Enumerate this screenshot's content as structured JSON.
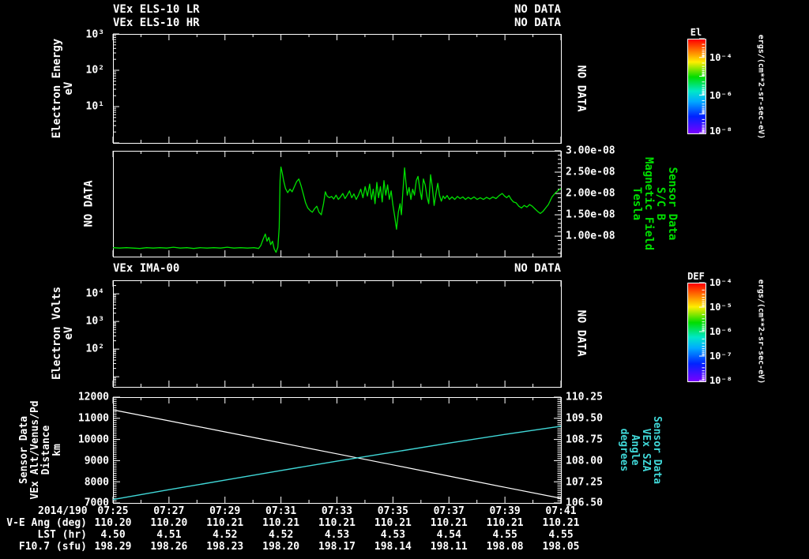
{
  "colors": {
    "white": "#ffffff",
    "green": "#00e000",
    "cyan": "#40d8d8",
    "background": "#000000"
  },
  "header": {
    "title1": "VEx ELS-10 LR",
    "title2": "VEx ELS-10 HR",
    "status1": "NO DATA",
    "status2": "NO DATA"
  },
  "els_panel": {
    "ylabel": "Electron Energy",
    "yunit": "eV",
    "yticks": [
      "10³",
      "10²",
      "10¹"
    ],
    "side_status": "NO DATA",
    "colorbar": {
      "title": "El",
      "tick_labels": [
        "10⁻⁴",
        "10⁻⁶",
        "10⁻⁸"
      ],
      "units": "ergs/(cm**2-sr-sec-eV)"
    }
  },
  "mag_panel": {
    "left_status": "NO DATA",
    "ytick_labels": [
      "3.00e-08",
      "2.50e-08",
      "2.00e-08",
      "1.50e-08",
      "1.00e-08"
    ],
    "side_labels": [
      "Sensor Data",
      "S/C B",
      "Magnetic Field",
      "Tesla"
    ]
  },
  "ima_panel": {
    "title": "VEx IMA-00",
    "status": "NO DATA",
    "ylabel": "Electron Volts",
    "yunit": "eV",
    "yticks": [
      "10⁴",
      "10³",
      "10²"
    ],
    "side_status": "NO DATA",
    "colorbar": {
      "title": "DEF",
      "tick_labels": [
        "10⁻⁴",
        "10⁻⁵",
        "10⁻⁶",
        "10⁻⁷",
        "10⁻⁸"
      ],
      "units": "ergs/(cm**2-sr-sec-eV)"
    }
  },
  "bottom_panel": {
    "left_ticks": [
      "12000",
      "11000",
      "10000",
      "9000",
      "8000",
      "7000"
    ],
    "right_ticks": [
      "110.25",
      "109.50",
      "108.75",
      "108.00",
      "107.25",
      "106.50"
    ],
    "left_labels": [
      "Sensor Data",
      "VEx Alt/Venus/Pd",
      "Distance",
      "km"
    ],
    "right_labels": [
      "Sensor Data",
      "VEx SZA",
      "Angle",
      "degrees"
    ]
  },
  "footer": {
    "date_label": "2014/190",
    "times": [
      "07:25",
      "07:27",
      "07:29",
      "07:31",
      "07:33",
      "07:35",
      "07:37",
      "07:39",
      "07:41"
    ],
    "rows": [
      {
        "label": "V-E Ang (deg)",
        "values": [
          "110.20",
          "110.20",
          "110.21",
          "110.21",
          "110.21",
          "110.21",
          "110.21",
          "110.21",
          "110.21"
        ]
      },
      {
        "label": "LST (hr)",
        "values": [
          "4.50",
          "4.51",
          "4.52",
          "4.52",
          "4.53",
          "4.53",
          "4.54",
          "4.55",
          "4.55"
        ]
      },
      {
        "label": "F10.7 (sfu)",
        "values": [
          "198.29",
          "198.26",
          "198.23",
          "198.20",
          "198.17",
          "198.14",
          "198.11",
          "198.08",
          "198.05"
        ]
      }
    ]
  },
  "chart_data": [
    {
      "type": "heatmap",
      "title": "VEx ELS-10 LR / VEx ELS-10 HR",
      "status": "NO DATA",
      "ylabel": "Electron Energy (eV)",
      "y_scale": "log",
      "ylim": [
        1,
        1000
      ],
      "x_range": [
        "07:25",
        "07:41"
      ],
      "colorbar": {
        "title": "El",
        "units": "ergs/(cm**2-sr-sec-eV)",
        "range": [
          0.001,
          1e-08
        ],
        "tick_labels": [
          "10^-4",
          "10^-6",
          "10^-8"
        ]
      },
      "data": []
    },
    {
      "type": "line",
      "title": "Sensor Data S/C B Magnetic Field (Tesla)",
      "left_status": "NO DATA",
      "x_range": [
        "07:25",
        "07:41"
      ],
      "ylim": [
        5.2e-09,
        3e-08
      ],
      "yticks": [
        3e-08,
        2.5e-08,
        2e-08,
        1.5e-08,
        1e-08
      ],
      "series": [
        {
          "name": "S/C B Magnetic Field (Tesla)",
          "color": "#00e000",
          "units_note": "points are [x_fraction_of_time_axis, B_in_1e-8_Tesla]",
          "points": [
            [
              0.0,
              0.73
            ],
            [
              0.015,
              0.72
            ],
            [
              0.03,
              0.73
            ],
            [
              0.045,
              0.72
            ],
            [
              0.06,
              0.71
            ],
            [
              0.075,
              0.73
            ],
            [
              0.09,
              0.72
            ],
            [
              0.105,
              0.73
            ],
            [
              0.12,
              0.72
            ],
            [
              0.135,
              0.74
            ],
            [
              0.15,
              0.72
            ],
            [
              0.165,
              0.73
            ],
            [
              0.18,
              0.71
            ],
            [
              0.195,
              0.73
            ],
            [
              0.21,
              0.72
            ],
            [
              0.225,
              0.73
            ],
            [
              0.24,
              0.72
            ],
            [
              0.255,
              0.74
            ],
            [
              0.27,
              0.72
            ],
            [
              0.285,
              0.73
            ],
            [
              0.3,
              0.72
            ],
            [
              0.315,
              0.73
            ],
            [
              0.325,
              0.71
            ],
            [
              0.33,
              0.78
            ],
            [
              0.335,
              0.92
            ],
            [
              0.34,
              1.05
            ],
            [
              0.344,
              0.88
            ],
            [
              0.348,
              0.97
            ],
            [
              0.352,
              0.8
            ],
            [
              0.356,
              0.88
            ],
            [
              0.36,
              0.7
            ],
            [
              0.364,
              0.62
            ],
            [
              0.368,
              0.74
            ],
            [
              0.371,
              1.2
            ],
            [
              0.373,
              2.3
            ],
            [
              0.375,
              2.62
            ],
            [
              0.378,
              2.48
            ],
            [
              0.381,
              2.3
            ],
            [
              0.385,
              2.12
            ],
            [
              0.39,
              2.02
            ],
            [
              0.395,
              2.1
            ],
            [
              0.4,
              2.04
            ],
            [
              0.405,
              2.16
            ],
            [
              0.41,
              2.28
            ],
            [
              0.415,
              2.34
            ],
            [
              0.42,
              2.18
            ],
            [
              0.425,
              1.98
            ],
            [
              0.43,
              1.78
            ],
            [
              0.435,
              1.66
            ],
            [
              0.44,
              1.6
            ],
            [
              0.445,
              1.56
            ],
            [
              0.45,
              1.64
            ],
            [
              0.455,
              1.7
            ],
            [
              0.46,
              1.56
            ],
            [
              0.465,
              1.5
            ],
            [
              0.47,
              1.76
            ],
            [
              0.474,
              2.04
            ],
            [
              0.478,
              1.94
            ],
            [
              0.483,
              1.9
            ],
            [
              0.488,
              1.93
            ],
            [
              0.493,
              1.87
            ],
            [
              0.498,
              1.96
            ],
            [
              0.503,
              1.86
            ],
            [
              0.508,
              1.92
            ],
            [
              0.513,
              2.0
            ],
            [
              0.518,
              1.88
            ],
            [
              0.523,
              1.96
            ],
            [
              0.528,
              2.06
            ],
            [
              0.533,
              1.9
            ],
            [
              0.538,
              1.99
            ],
            [
              0.543,
              1.86
            ],
            [
              0.548,
              1.96
            ],
            [
              0.553,
              2.1
            ],
            [
              0.558,
              1.9
            ],
            [
              0.563,
              2.16
            ],
            [
              0.568,
              1.94
            ],
            [
              0.573,
              2.22
            ],
            [
              0.577,
              1.86
            ],
            [
              0.581,
              2.1
            ],
            [
              0.585,
              1.76
            ],
            [
              0.589,
              2.26
            ],
            [
              0.593,
              1.9
            ],
            [
              0.597,
              2.16
            ],
            [
              0.601,
              1.8
            ],
            [
              0.605,
              2.3
            ],
            [
              0.609,
              1.96
            ],
            [
              0.613,
              2.2
            ],
            [
              0.617,
              1.86
            ],
            [
              0.621,
              2.06
            ],
            [
              0.625,
              1.72
            ],
            [
              0.629,
              1.46
            ],
            [
              0.633,
              1.16
            ],
            [
              0.637,
              1.56
            ],
            [
              0.641,
              1.76
            ],
            [
              0.644,
              1.5
            ],
            [
              0.647,
              2.0
            ],
            [
              0.651,
              2.6
            ],
            [
              0.654,
              2.26
            ],
            [
              0.657,
              1.96
            ],
            [
              0.661,
              2.14
            ],
            [
              0.665,
              1.86
            ],
            [
              0.669,
              2.1
            ],
            [
              0.673,
              1.96
            ],
            [
              0.677,
              2.3
            ],
            [
              0.681,
              2.4
            ],
            [
              0.685,
              2.1
            ],
            [
              0.689,
              1.86
            ],
            [
              0.693,
              2.34
            ],
            [
              0.697,
              2.2
            ],
            [
              0.701,
              1.92
            ],
            [
              0.705,
              1.76
            ],
            [
              0.709,
              2.44
            ],
            [
              0.713,
              2.14
            ],
            [
              0.717,
              1.72
            ],
            [
              0.721,
              2.0
            ],
            [
              0.725,
              2.24
            ],
            [
              0.729,
              1.96
            ],
            [
              0.733,
              1.82
            ],
            [
              0.737,
              1.94
            ],
            [
              0.741,
              1.88
            ],
            [
              0.746,
              1.95
            ],
            [
              0.751,
              1.86
            ],
            [
              0.757,
              1.92
            ],
            [
              0.763,
              1.86
            ],
            [
              0.769,
              1.93
            ],
            [
              0.775,
              1.88
            ],
            [
              0.781,
              1.92
            ],
            [
              0.787,
              1.86
            ],
            [
              0.793,
              1.91
            ],
            [
              0.799,
              1.87
            ],
            [
              0.806,
              1.92
            ],
            [
              0.813,
              1.86
            ],
            [
              0.82,
              1.9
            ],
            [
              0.827,
              1.86
            ],
            [
              0.834,
              1.91
            ],
            [
              0.841,
              1.87
            ],
            [
              0.848,
              1.92
            ],
            [
              0.855,
              1.88
            ],
            [
              0.862,
              1.95
            ],
            [
              0.869,
              2.0
            ],
            [
              0.874,
              1.94
            ],
            [
              0.879,
              1.9
            ],
            [
              0.884,
              1.95
            ],
            [
              0.889,
              1.86
            ],
            [
              0.894,
              1.8
            ],
            [
              0.9,
              1.78
            ],
            [
              0.906,
              1.7
            ],
            [
              0.912,
              1.66
            ],
            [
              0.918,
              1.72
            ],
            [
              0.924,
              1.68
            ],
            [
              0.93,
              1.74
            ],
            [
              0.936,
              1.7
            ],
            [
              0.942,
              1.64
            ],
            [
              0.948,
              1.58
            ],
            [
              0.954,
              1.53
            ],
            [
              0.96,
              1.58
            ],
            [
              0.966,
              1.66
            ],
            [
              0.972,
              1.74
            ],
            [
              0.98,
              1.92
            ],
            [
              0.988,
              2.02
            ],
            [
              0.995,
              2.08
            ],
            [
              1.0,
              2.12
            ]
          ]
        }
      ]
    },
    {
      "type": "heatmap",
      "title": "VEx IMA-00",
      "status": "NO DATA",
      "ylabel": "Electron Volts (eV)",
      "y_scale": "log",
      "yticks": [
        10000,
        1000,
        100
      ],
      "x_range": [
        "07:25",
        "07:41"
      ],
      "colorbar": {
        "title": "DEF",
        "units": "ergs/(cm**2-sr-sec-eV)",
        "range": [
          0.0001,
          1e-08
        ],
        "tick_labels": [
          "10^-4",
          "10^-5",
          "10^-6",
          "10^-7",
          "10^-8"
        ]
      },
      "data": []
    },
    {
      "type": "line",
      "title": "Sensor Data VEx Alt/Venus/Pd Distance (km) and VEx SZA Angle (degrees)",
      "x": [
        "07:25",
        "07:27",
        "07:29",
        "07:31",
        "07:33",
        "07:35",
        "07:37",
        "07:39",
        "07:41"
      ],
      "ylim_left": [
        7000,
        12000
      ],
      "ylim_right": [
        106.5,
        110.25
      ],
      "series": [
        {
          "name": "VEx Alt/Venus/Pd Distance (km)",
          "axis": "left",
          "color": "#ffffff",
          "values": [
            11400,
            10880,
            10360,
            9840,
            9320,
            8800,
            8270,
            7740,
            7220
          ]
        },
        {
          "name": "VEx SZA Angle (degrees)",
          "axis": "right",
          "color": "#40d8d8",
          "values": [
            106.62,
            106.97,
            107.31,
            107.65,
            107.98,
            108.3,
            108.62,
            108.93,
            109.22
          ]
        }
      ]
    }
  ]
}
